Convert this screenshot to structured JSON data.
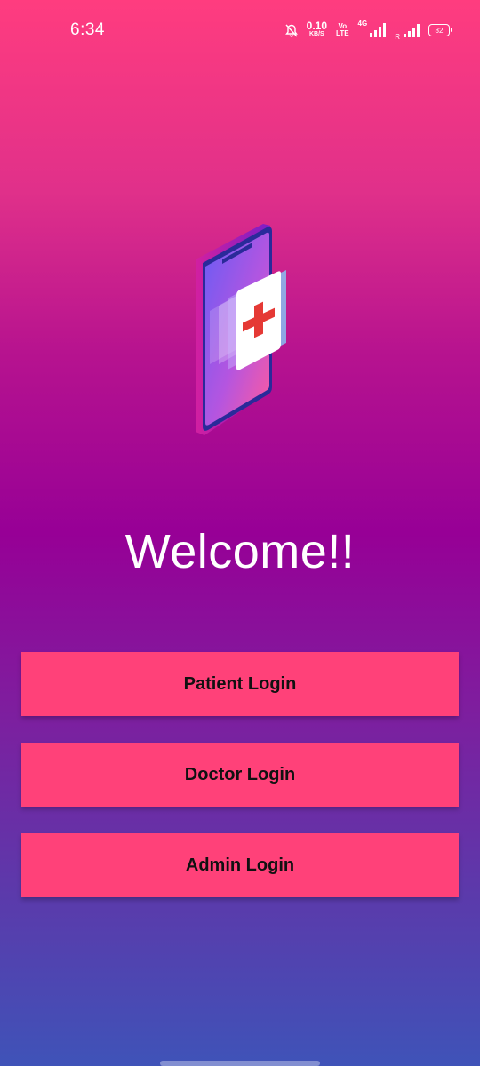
{
  "status_bar": {
    "time": "6:34",
    "net_speed_value": "0.10",
    "net_speed_unit": "KB/S",
    "volte_top": "Vo",
    "volte_bottom": "LTE",
    "network_type": "4G",
    "roaming": "R",
    "battery": "82",
    "icons": [
      "mute-bell-icon",
      "signal-icon",
      "signal-icon",
      "battery-icon"
    ]
  },
  "hero": {
    "illustration": "medical-phone-icon",
    "welcome_text": "Welcome!!"
  },
  "buttons": {
    "patient": "Patient Login",
    "doctor": "Doctor Login",
    "admin": "Admin Login"
  },
  "colors": {
    "button_bg": "#ff4179",
    "button_text": "#111111",
    "gradient_top": "#ff3c7f",
    "gradient_mid": "#970096",
    "gradient_bottom": "#3f53b8",
    "cross_red": "#e53935"
  }
}
